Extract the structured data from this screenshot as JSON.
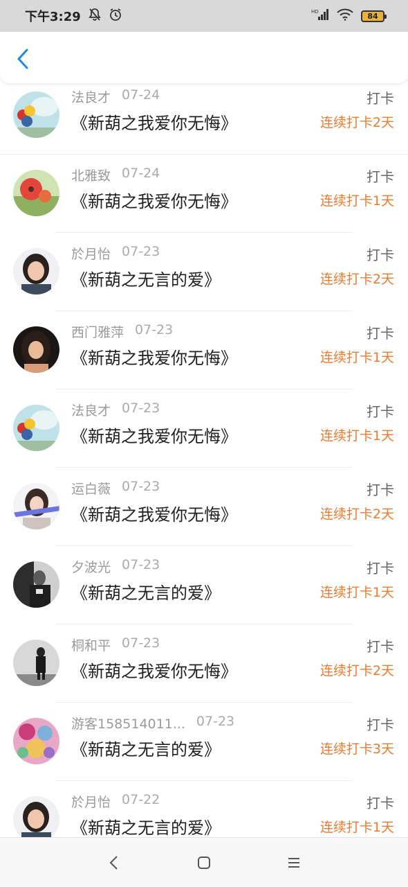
{
  "status_bar": {
    "time": "下午3:29",
    "battery": "84",
    "icons": [
      "mute-bell-icon",
      "alarm-icon",
      "hd-signal-icon",
      "wifi-icon",
      "battery-icon"
    ]
  },
  "header": {
    "back_icon": "chevron-left-icon",
    "accent_color": "#1e88e5"
  },
  "checkins": [
    {
      "user": "法良才",
      "date": "07-24",
      "book": "《新葫之我爱你无悔》",
      "type": "打卡",
      "streak": "连续打卡2天",
      "avatar": "balloons-sky"
    },
    {
      "user": "北雅致",
      "date": "07-24",
      "book": "《新葫之我爱你无悔》",
      "type": "打卡",
      "streak": "连续打卡1天",
      "avatar": "red-flowers"
    },
    {
      "user": "於月怡",
      "date": "07-23",
      "book": "《新葫之无言的爱》",
      "type": "打卡",
      "streak": "连续打卡2天",
      "avatar": "smiling-woman"
    },
    {
      "user": "西门雅萍",
      "date": "07-23",
      "book": "《新葫之我爱你无悔》",
      "type": "打卡",
      "streak": "连续打卡1天",
      "avatar": "woman-portrait"
    },
    {
      "user": "法良才",
      "date": "07-23",
      "book": "《新葫之我爱你无悔》",
      "type": "打卡",
      "streak": "连续打卡1天",
      "avatar": "balloons-sky"
    },
    {
      "user": "运白薇",
      "date": "07-23",
      "book": "《新葫之我爱你无悔》",
      "type": "打卡",
      "streak": "连续打卡2天",
      "avatar": "girl-banner"
    },
    {
      "user": "夕波光",
      "date": "07-23",
      "book": "《新葫之无言的爱》",
      "type": "打卡",
      "streak": "连续打卡1天",
      "avatar": "bw-portrait"
    },
    {
      "user": "桐和平",
      "date": "07-23",
      "book": "《新葫之我爱你无悔》",
      "type": "打卡",
      "streak": "连续打卡2天",
      "avatar": "bw-wall"
    },
    {
      "user": "游客158514011...",
      "date": "07-23",
      "book": "《新葫之无言的爱》",
      "type": "打卡",
      "streak": "连续打卡3天",
      "avatar": "anime-colorful"
    },
    {
      "user": "於月怡",
      "date": "07-22",
      "book": "《新葫之无言的爱》",
      "type": "打卡",
      "streak": "连续打卡1天",
      "avatar": "smiling-woman"
    }
  ],
  "colors": {
    "streak": "#ef7a2e",
    "meta": "#9a9a9a",
    "status_bar_bg": "#d9d9d9"
  },
  "nav_bar": {
    "icons": [
      "back-nav-icon",
      "home-nav-icon",
      "menu-nav-icon"
    ]
  }
}
